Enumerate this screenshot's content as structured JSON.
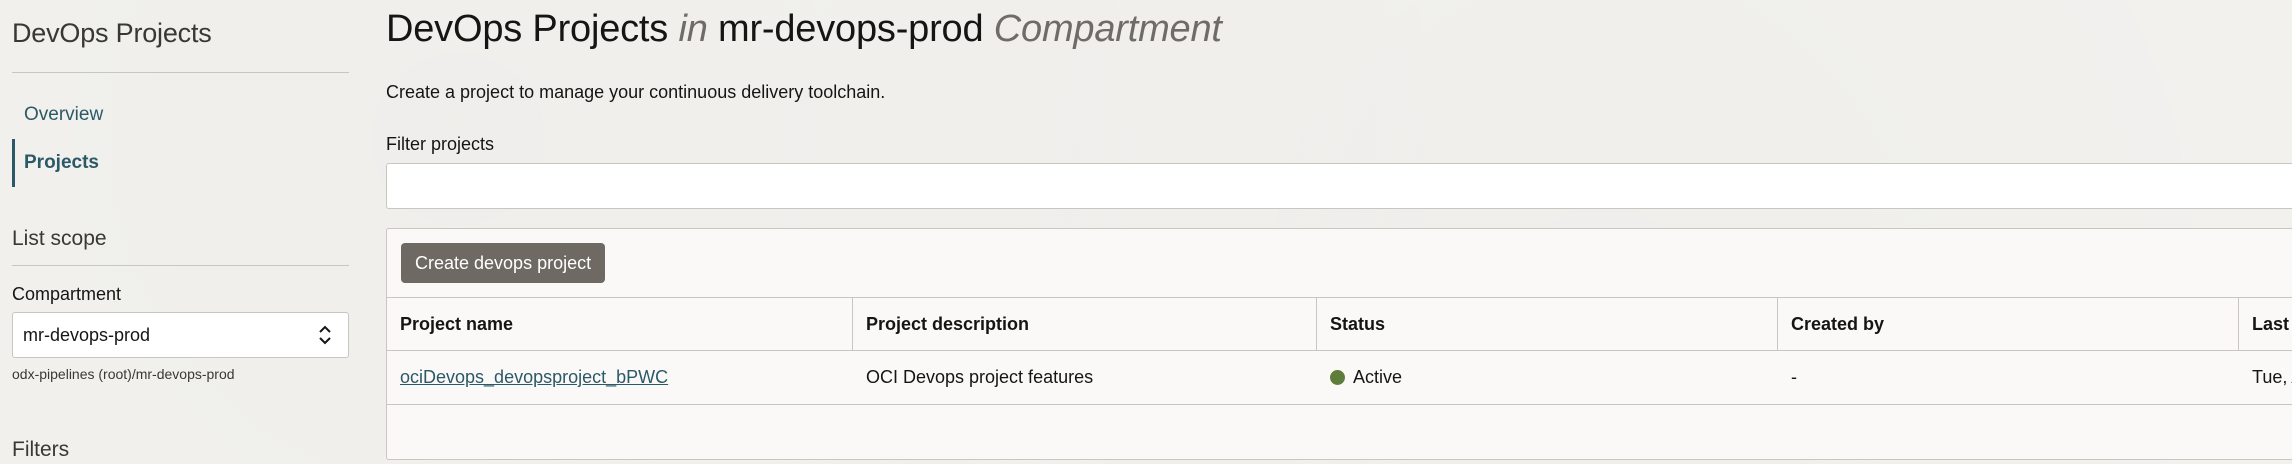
{
  "sidebar": {
    "title": "DevOps Projects",
    "nav": [
      {
        "label": "Overview",
        "active": false
      },
      {
        "label": "Projects",
        "active": true
      }
    ],
    "list_scope_title": "List scope",
    "compartment_label": "Compartment",
    "compartment_value": "mr-devops-prod",
    "compartment_path": "odx-pipelines (root)/mr-devops-prod",
    "filters_title": "Filters"
  },
  "main": {
    "title_part1": "DevOps Projects",
    "title_in": "in",
    "title_compartment": "mr-devops-prod",
    "title_suffix": "Compartment",
    "subtitle": "Create a project to manage your continuous delivery toolchain.",
    "filter_label": "Filter projects",
    "filter_value": "",
    "create_button": "Create devops project",
    "table": {
      "headers": [
        "Project name",
        "Project description",
        "Status",
        "Created by",
        "Last"
      ],
      "rows": [
        {
          "name": "ociDevops_devopsproject_bPWC",
          "description": "OCI Devops project features",
          "status": "Active",
          "created_by": "-",
          "last": "Tue, A"
        }
      ]
    }
  },
  "colors": {
    "link": "#2c5967",
    "status_active": "#5f7d3a",
    "button_bg": "#6f6964"
  },
  "icons": {
    "compartment_select": "chevron-up-down-icon",
    "status": "status-dot-icon"
  }
}
